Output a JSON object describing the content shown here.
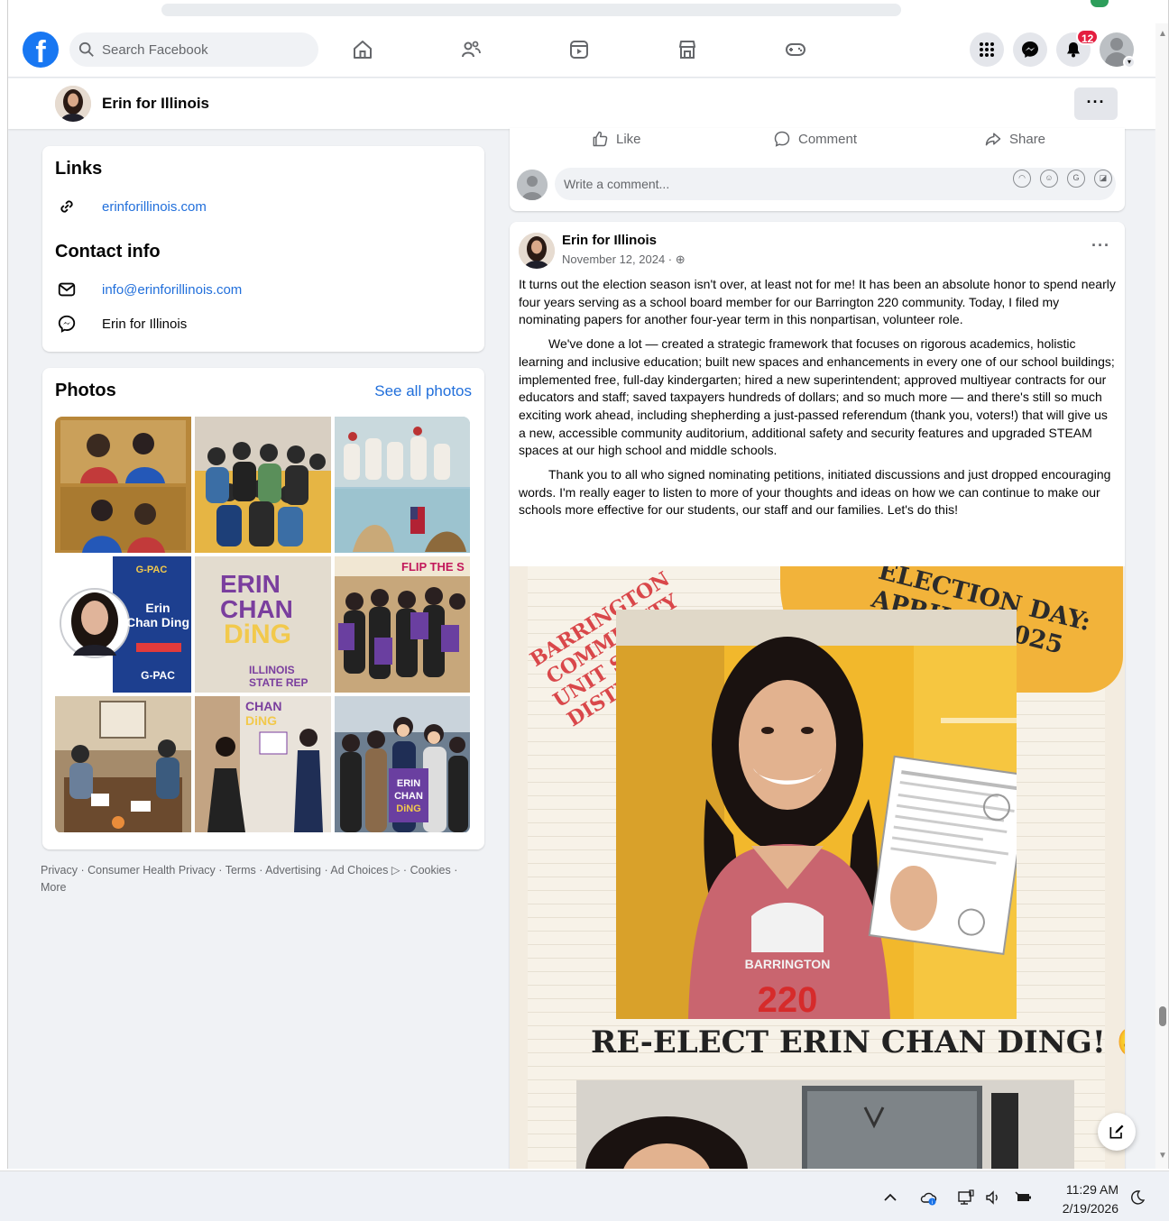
{
  "nav": {
    "search_placeholder": "Search Facebook",
    "notification_count": "12"
  },
  "page_header": {
    "name": "Erin for Illinois",
    "more": "···"
  },
  "links_card": {
    "title": "Links",
    "website": "erinforillinois.com"
  },
  "contact_card": {
    "title": "Contact info",
    "email": "info@erinforillinois.com",
    "messenger": "Erin for Illinois"
  },
  "photos_card": {
    "title": "Photos",
    "see_all": "See all photos",
    "tile_texts": {
      "gpac_title": "G-PAC",
      "gpac_name": "Erin\nChan Ding",
      "gpac_footer": "G-PAC",
      "erin_title": "ERIN\nCHAN",
      "erin_ding": "DiNG",
      "erin_sub": "ILLINOIS\nSTATE REP",
      "flip": "FLIP  THE  S"
    }
  },
  "footer": {
    "links": [
      "Privacy",
      "Consumer Health Privacy",
      "Terms",
      "Advertising",
      "Ad Choices",
      "Cookies",
      "More"
    ]
  },
  "actions": {
    "like": "Like",
    "comment": "Comment",
    "share": "Share",
    "comment_placeholder": "Write a comment..."
  },
  "post": {
    "author": "Erin for Illinois",
    "date": "November 12, 2024 · ",
    "more": "···",
    "paragraphs": [
      "It turns out the election season isn't over, at least not for me! It has been an absolute honor to spend nearly four years serving as a school board member for our Barrington 220 community. Today, I filed my nominating papers for another four-year term in this nonpartisan, volunteer role.",
      "We've done a lot — created a strategic framework that focuses on rigorous academics, holistic learning and inclusive education; built new spaces and enhancements in every one of our school buildings; implemented free, full-day kindergarten; hired a new superintendent; approved multiyear contracts for our educators and staff; saved taxpayers hundreds of dollars; and so much more — and there's still so much exciting work ahead, including shepherding a just-passed referendum (thank you, voters!) that will give us a new, accessible community auditorium, additional safety and security features and upgraded STEAM spaces at our high school and middle schools.",
      "Thank you to all who signed nominating petitions, initiated discussions and just dropped encouraging words. I'm really eager to listen to more of your thoughts and ideas on how we can continue to make our schools more effective for our students, our staff and our families. Let's do this!"
    ],
    "image": {
      "district": "BARRINGTON\nCOMMUNITY\nUNIT SCHOOL\nDISTRICT 220",
      "election": "ELECTION DAY:\nAPRIL 1, 2025",
      "shirt": "BARRINGTON",
      "shirt_num": "220",
      "headline": "RE-ELECT ERIN CHAN DING! 😄"
    }
  },
  "taskbar": {
    "time": "11:29 AM",
    "date": "2/19/2026"
  },
  "colors": {
    "brand": "#1877f2",
    "link": "#216fdb",
    "badge": "#e41e3f",
    "background": "#f0f2f5"
  }
}
